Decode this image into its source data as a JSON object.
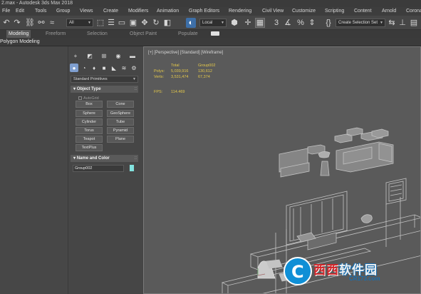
{
  "window": {
    "title": "2.max - Autodesk 3ds Max 2018"
  },
  "menu": [
    "File",
    "Edit",
    "Tools",
    "Group",
    "Views",
    "Create",
    "Modifiers",
    "Animation",
    "Graph Editors",
    "Rendering",
    "Civil View",
    "Customize",
    "Scripting",
    "Content",
    "Arnold",
    "Corona"
  ],
  "toolbar": {
    "filter_dropdown": "All",
    "coord_dropdown": "Local",
    "selection_set": "Create Selection Set"
  },
  "ribbon": {
    "tabs": [
      "Modeling",
      "Freeform",
      "Selection",
      "Object Paint",
      "Populate"
    ],
    "active_tab": "Modeling",
    "sub_label": "Polygon Modeling"
  },
  "command_panel": {
    "category_dropdown": "Standard Primitives",
    "object_type_title": "Object Type",
    "autogrid_label": "AutoGrid",
    "primitives": [
      "Box",
      "Cone",
      "Sphere",
      "GeoSphere",
      "Cylinder",
      "Tube",
      "Torus",
      "Pyramid",
      "Teapot",
      "Plane",
      "TextPlus"
    ],
    "name_color_title": "Name and Color",
    "object_name": "Group002",
    "object_color": "#83e3df"
  },
  "viewport": {
    "label": "[+] [Perspective] [Standard] [Wireframe]",
    "stats": {
      "header_total": "Total",
      "header_group": "Group002",
      "rows": [
        {
          "label": "Polys:",
          "total": "5,039,916",
          "group": "130,612"
        },
        {
          "label": "Verts:",
          "total": "3,531,474",
          "group": "67,374"
        }
      ],
      "fps_label": "FPS:",
      "fps_value": "114.469"
    }
  },
  "watermark": {
    "text_a": "西西",
    "text_b": "软件园",
    "url": "CR173.com"
  }
}
